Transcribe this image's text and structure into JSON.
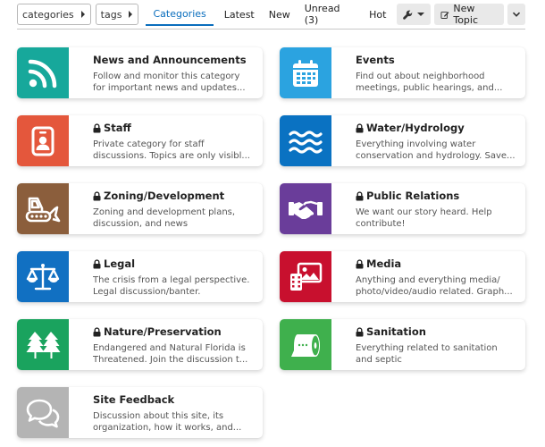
{
  "nav": {
    "categories_dropdown": "categories",
    "tags_dropdown": "tags",
    "tabs": [
      {
        "label": "Categories"
      },
      {
        "label": "Latest"
      },
      {
        "label": "New"
      },
      {
        "label": "Unread (3)"
      },
      {
        "label": "Hot"
      }
    ],
    "new_topic_label": "New Topic"
  },
  "colors": {
    "accent": "#0a6ebd",
    "news": "#17a89b",
    "events": "#2ba3e0",
    "staff": "#e4573c",
    "water": "#0a72c2",
    "zoning": "#8b5e3c",
    "pr": "#6a3d9a",
    "legal": "#1170c2",
    "media": "#c8102e",
    "nature": "#1aa35e",
    "sanitation": "#3fb04d",
    "feedback": "#b4b4b4"
  },
  "categories": [
    {
      "name": "News and Announcements",
      "locked": false,
      "icon": "rss-icon",
      "desc1": "Follow and monitor this category",
      "desc2": "for important news and updates..."
    },
    {
      "name": "Events",
      "locked": false,
      "icon": "calendar-icon",
      "desc1": "Find out about neighborhood",
      "desc2": "meetings, public hearings, and..."
    },
    {
      "name": "Staff",
      "locked": true,
      "icon": "id-badge-icon",
      "desc1": "Private category for staff",
      "desc2": "discussions. Topics are only visibl..."
    },
    {
      "name": "Water/Hydrology",
      "locked": true,
      "icon": "water-icon",
      "desc1": "Everything involving water",
      "desc2": "conservation and hydrology. Save..."
    },
    {
      "name": "Zoning/Development",
      "locked": true,
      "icon": "bulldozer-icon",
      "desc1": "Zoning and development plans,",
      "desc2": "discussion, and news"
    },
    {
      "name": "Public Relations",
      "locked": true,
      "icon": "handshake-icon",
      "desc1": "We want our story heard. Help",
      "desc2": "contribute!"
    },
    {
      "name": "Legal",
      "locked": true,
      "icon": "balance-scale-icon",
      "desc1": "The crisis from a legal perspective.",
      "desc2": "Legal discussion/banter."
    },
    {
      "name": "Media",
      "locked": true,
      "icon": "photo-video-icon",
      "desc1": "Anything and everything media/",
      "desc2": "photo/video/audio related. Graph..."
    },
    {
      "name": "Nature/Preservation",
      "locked": true,
      "icon": "trees-icon",
      "desc1": "Endangered and Natural Florida is",
      "desc2": "Threatened. Join the discussion t..."
    },
    {
      "name": "Sanitation",
      "locked": true,
      "icon": "toilet-paper-icon",
      "desc1": "Everything related to sanitation",
      "desc2": "and septic"
    },
    {
      "name": "Site Feedback",
      "locked": false,
      "icon": "comments-icon",
      "desc1": "Discussion about this site, its",
      "desc2": "organization, how it works, and..."
    }
  ]
}
